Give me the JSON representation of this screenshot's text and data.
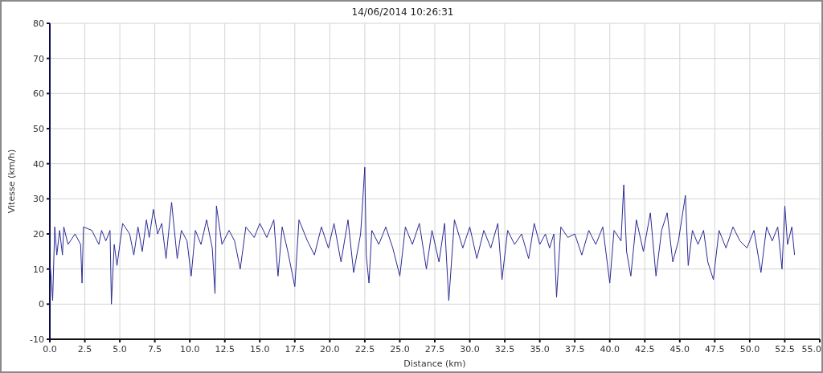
{
  "chart": {
    "chart_data": {
      "type": "line",
      "title": "14/06/2014 10:26:31",
      "xlabel": "Distance (km)",
      "ylabel": "Vitesse (km/h)",
      "xlim": [
        0,
        55
      ],
      "ylim": [
        -10,
        80
      ],
      "xticks": [
        {
          "value": 0,
          "label": "0.0"
        },
        {
          "value": 2.5,
          "label": "2.5"
        },
        {
          "value": 5,
          "label": "5.0"
        },
        {
          "value": 7.5,
          "label": "7.5"
        },
        {
          "value": 10,
          "label": "10.0"
        },
        {
          "value": 12.5,
          "label": "12.5"
        },
        {
          "value": 15,
          "label": "15.0"
        },
        {
          "value": 17.5,
          "label": "17.5"
        },
        {
          "value": 20,
          "label": "20.0"
        },
        {
          "value": 22.5,
          "label": "22.5"
        },
        {
          "value": 25,
          "label": "25.0"
        },
        {
          "value": 27.5,
          "label": "27.5"
        },
        {
          "value": 30,
          "label": "30.0"
        },
        {
          "value": 32.5,
          "label": "32.5"
        },
        {
          "value": 35,
          "label": "35.0"
        },
        {
          "value": 37.5,
          "label": "37.5"
        },
        {
          "value": 40,
          "label": "40.0"
        },
        {
          "value": 42.5,
          "label": "42.5"
        },
        {
          "value": 45,
          "label": "45.0"
        },
        {
          "value": 47.5,
          "label": "47.5"
        },
        {
          "value": 50,
          "label": "50.0"
        },
        {
          "value": 52.5,
          "label": "52.5"
        },
        {
          "value": 55,
          "label": "55.0"
        }
      ],
      "yticks": [
        -10,
        0,
        10,
        20,
        30,
        40,
        50,
        60,
        70,
        80
      ],
      "x": [
        0.05,
        0.2,
        0.35,
        0.5,
        0.7,
        0.9,
        1.0,
        1.3,
        1.8,
        2.2,
        2.3,
        2.4,
        3.0,
        3.5,
        3.7,
        4.0,
        4.3,
        4.4,
        4.6,
        4.8,
        5.2,
        5.7,
        6.0,
        6.3,
        6.6,
        6.9,
        7.1,
        7.4,
        7.7,
        8.0,
        8.3,
        8.7,
        9.1,
        9.4,
        9.8,
        10.1,
        10.4,
        10.8,
        11.2,
        11.6,
        11.8,
        11.9,
        12.3,
        12.8,
        13.2,
        13.6,
        14.0,
        14.6,
        15.0,
        15.5,
        16.0,
        16.3,
        16.6,
        17.0,
        17.5,
        17.8,
        18.4,
        18.9,
        19.4,
        19.9,
        20.3,
        20.8,
        21.3,
        21.7,
        22.2,
        22.5,
        22.6,
        22.8,
        23.0,
        23.5,
        24.0,
        24.5,
        25.0,
        25.4,
        25.9,
        26.4,
        26.9,
        27.3,
        27.8,
        28.2,
        28.5,
        28.9,
        29.5,
        30.0,
        30.5,
        31.0,
        31.5,
        32.0,
        32.3,
        32.7,
        33.2,
        33.7,
        34.2,
        34.6,
        35.0,
        35.4,
        35.7,
        36.0,
        36.2,
        36.5,
        37.0,
        37.5,
        38.0,
        38.5,
        39.0,
        39.5,
        40.0,
        40.3,
        40.8,
        41.0,
        41.2,
        41.5,
        41.9,
        42.4,
        42.9,
        43.3,
        43.7,
        44.1,
        44.5,
        44.9,
        45.4,
        45.6,
        45.9,
        46.3,
        46.7,
        47.0,
        47.4,
        47.8,
        48.3,
        48.8,
        49.3,
        49.8,
        50.3,
        50.8,
        51.2,
        51.6,
        52.0,
        52.3,
        52.5,
        52.7,
        53.0,
        53.2
      ],
      "grid": true,
      "series": [
        {
          "color": "#2b2b96",
          "values": [
            10,
            1,
            22,
            14,
            21,
            14,
            22,
            17,
            20,
            17,
            6,
            22,
            21,
            17,
            21,
            18,
            21,
            0,
            17,
            11,
            23,
            20,
            14,
            22,
            15,
            24,
            19,
            27,
            20,
            23,
            13,
            29,
            13,
            21,
            18,
            8,
            21,
            17,
            24,
            16,
            3,
            28,
            17,
            21,
            18,
            10,
            22,
            19,
            23,
            19,
            24,
            8,
            22,
            15,
            5,
            24,
            18,
            14,
            22,
            16,
            23,
            12,
            24,
            9,
            20,
            39,
            14,
            6,
            21,
            17,
            22,
            16,
            8,
            22,
            17,
            23,
            10,
            21,
            12,
            23,
            1,
            24,
            16,
            22,
            13,
            21,
            16,
            23,
            7,
            21,
            17,
            20,
            13,
            23,
            17,
            20,
            16,
            20,
            2,
            22,
            19,
            20,
            14,
            21,
            17,
            22,
            6,
            21,
            18,
            34,
            15,
            8,
            24,
            15,
            26,
            8,
            21,
            26,
            12,
            18,
            31,
            11,
            21,
            17,
            21,
            12,
            7,
            21,
            16,
            22,
            18,
            16,
            21,
            9,
            22,
            18,
            22,
            10,
            28,
            17,
            22,
            14
          ]
        }
      ]
    }
  }
}
